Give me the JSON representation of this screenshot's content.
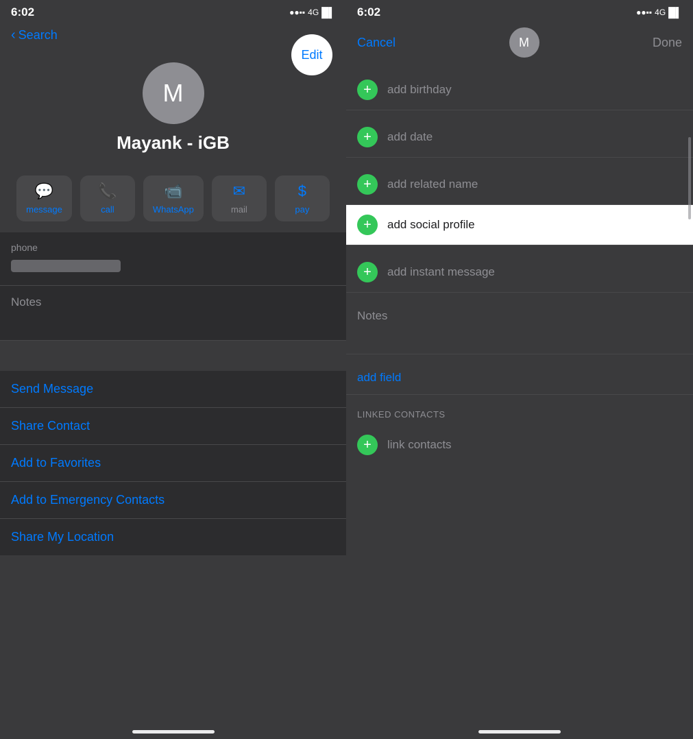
{
  "left": {
    "status": {
      "time": "6:02",
      "signal": "▲▲▲",
      "network": "4G",
      "battery": "▐▌"
    },
    "nav": {
      "back_label": "Search",
      "edit_label": "Edit"
    },
    "avatar": {
      "initial": "M"
    },
    "contact_name": "Mayank - iGB",
    "actions": [
      {
        "icon": "💬",
        "label": "message"
      },
      {
        "icon": "📞",
        "label": "call"
      },
      {
        "icon": "📹",
        "label": "WhatsApp"
      },
      {
        "icon": "✉",
        "label": "mail"
      },
      {
        "icon": "$",
        "label": "pay"
      }
    ],
    "phone_label": "phone",
    "notes_label": "Notes",
    "links": [
      "Send Message",
      "Share Contact",
      "Add to Favorites",
      "Add to Emergency Contacts",
      "Share My Location"
    ]
  },
  "right": {
    "status": {
      "time": "6:02",
      "signal": "▲▲",
      "network": "4G",
      "battery": "▐▌"
    },
    "nav": {
      "cancel_label": "Cancel",
      "done_label": "Done",
      "avatar_initial": "M"
    },
    "add_rows": [
      {
        "label": "add birthday",
        "highlighted": false
      },
      {
        "label": "add date",
        "highlighted": false
      },
      {
        "label": "add related name",
        "highlighted": false
      },
      {
        "label": "add social profile",
        "highlighted": true
      },
      {
        "label": "add instant message",
        "highlighted": false
      }
    ],
    "notes_label": "Notes",
    "add_field_label": "add field",
    "linked_contacts_title": "LINKED CONTACTS",
    "link_contacts_label": "link contacts"
  }
}
